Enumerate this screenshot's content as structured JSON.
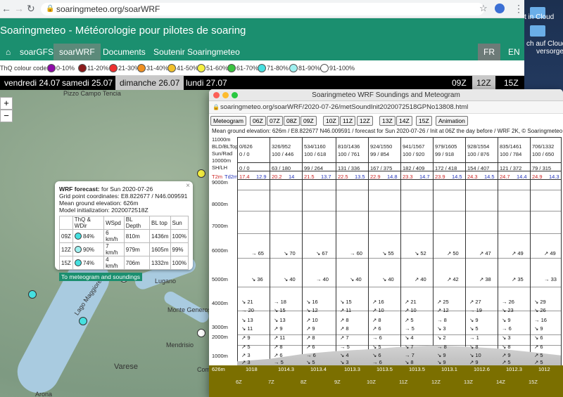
{
  "browser": {
    "url": "soaringmeteo.org/soarWRF"
  },
  "site": {
    "title": "Soaringmeteo - Météorologie pour pilotes de soaring",
    "nav": [
      "soarGFS",
      "soarWRF",
      "Documents",
      "Soutenir Soaringmeteo"
    ],
    "lang": [
      "FR",
      "EN"
    ]
  },
  "colour_code": {
    "label": "ThQ colour code:",
    "items": [
      {
        "label": "0-10%",
        "color": "#8e0aa8"
      },
      {
        "label": "11-20%",
        "color": "#8b1a1a"
      },
      {
        "label": "21-30%",
        "color": "#ee3030"
      },
      {
        "label": "31-40%",
        "color": "#f09020"
      },
      {
        "label": "41-50%",
        "color": "#f2c12a"
      },
      {
        "label": "51-60%",
        "color": "#f5f040"
      },
      {
        "label": "61-70%",
        "color": "#39c43f"
      },
      {
        "label": "71-80%",
        "color": "#46e0e0"
      },
      {
        "label": "81-90%",
        "color": "#9ef0f0"
      },
      {
        "label": "91-100%",
        "color": "#ffffff"
      }
    ]
  },
  "days": [
    "vendredi 24.07",
    "samedi 25.07",
    "dimanche 26.07",
    "lundi 27.07"
  ],
  "hours": [
    "09Z",
    "12Z",
    "15Z"
  ],
  "map_labels": [
    "Pizzo Campo Tencia",
    "Lugano",
    "Lago Maggiore",
    "Monte Generoso",
    "Mendrisio",
    "Varese",
    "Arona",
    "Como"
  ],
  "popup": {
    "title_bold": "WRF forecast:",
    "title_rest": " for Sun 2020-07-26",
    "lines": [
      "Grid point coordinates: E8.822677 / N46.009591",
      "Mean ground elevation: 626m",
      "Model initialization: 2020072518Z"
    ],
    "headers": [
      "",
      "ThQ & WDir",
      "WSpd",
      "BL Depth",
      "BL top",
      "Sun"
    ],
    "rows": [
      [
        "09Z",
        "84%",
        "6 km/h",
        "810m",
        "1436m",
        "100%"
      ],
      [
        "12Z",
        "90%",
        "7 km/h",
        "979m",
        "1605m",
        "99%"
      ],
      [
        "15Z",
        "74%",
        "4 km/h",
        "706m",
        "1332m",
        "100%"
      ]
    ],
    "link": "To meteogram and soundings"
  },
  "window": {
    "title": "Soaringmeteo WRF Soundings and Meteogram",
    "url": "soaringmeteo.org/soarWRF/2020-07-26/metSoundInit2020072518GPNo13808.html",
    "buttons": [
      "Meteogram",
      "06Z",
      "07Z",
      "08Z",
      "09Z",
      "10Z",
      "11Z",
      "12Z",
      "13Z",
      "14Z",
      "15Z",
      "Animation"
    ],
    "info": "Mean ground elevation: 626m / E8.822677 N46.009591 / forecast for Sun 2020-07-26 / Init at 06Z the day before / WRF 2K, © Soaringmeteo.",
    "row_labels": [
      "11000m",
      "BLD/BLTop",
      "Sun/Rad",
      "10000m",
      "SH/LH",
      "T2m",
      "Td2m",
      "9000m",
      "8000m",
      "7000m",
      "6000m",
      "5000m",
      "4000m",
      "3000m",
      "2000m",
      "1000m",
      "626m"
    ],
    "columns": [
      {
        "bld": "0/626",
        "sun": "0 / 0",
        "shlh": "0 / 0",
        "t2m": "17.4",
        "td2m": "12.9",
        "p": "1018"
      },
      {
        "bld": "326/952",
        "sun": "100 / 446",
        "shlh": "63 / 180",
        "t2m": "20.2",
        "td2m": "14",
        "p": "1014.3"
      },
      {
        "bld": "534/1160",
        "sun": "100 / 618",
        "shlh": "99 / 264",
        "t2m": "21.5",
        "td2m": "13.7",
        "p": "1013.4"
      },
      {
        "bld": "810/1436",
        "sun": "100 / 761",
        "shlh": "131 / 336",
        "t2m": "22.5",
        "td2m": "13.5",
        "p": "1013.3"
      },
      {
        "bld": "924/1550",
        "sun": "99 / 854",
        "shlh": "167 / 375",
        "t2m": "22.9",
        "td2m": "14.8",
        "p": "1013.5"
      },
      {
        "bld": "941/1567",
        "sun": "100 / 920",
        "shlh": "182 / 409",
        "t2m": "23.3",
        "td2m": "14.7",
        "p": "1013.5"
      },
      {
        "bld": "979/1605",
        "sun": "99 / 918",
        "shlh": "172 / 418",
        "t2m": "23.9",
        "td2m": "14.5",
        "p": "1013.1"
      },
      {
        "bld": "928/1554",
        "sun": "100 / 876",
        "shlh": "154 / 407",
        "t2m": "24.3",
        "td2m": "14.5",
        "p": "1012.6"
      },
      {
        "bld": "835/1461",
        "sun": "100 / 784",
        "shlh": "121 / 372",
        "t2m": "24.7",
        "td2m": "14.4",
        "p": "1012.3"
      },
      {
        "bld": "706/1332",
        "sun": "100 / 650",
        "shlh": "79 / 315",
        "t2m": "24.9",
        "td2m": "14.3",
        "p": "1012"
      }
    ],
    "wind_rows": [
      [
        "65",
        "70",
        "67",
        "60",
        "55",
        "52",
        "50",
        "47",
        "49",
        "49"
      ],
      [
        "36",
        "40",
        "40",
        "40",
        "40",
        "40",
        "42",
        "38",
        "35",
        "33"
      ],
      [
        "21",
        "18",
        "16",
        "15",
        "16",
        "21",
        "25",
        "27",
        "26",
        "29"
      ],
      [
        "20",
        "15",
        "12",
        "11",
        "10",
        "10",
        "12",
        "19",
        "23",
        "26"
      ],
      [
        "13",
        "13",
        "10",
        "8",
        "8",
        "5",
        "8",
        "9",
        "9",
        "16"
      ],
      [
        "11",
        "9",
        "9",
        "8",
        "6",
        "5",
        "3",
        "5",
        "6",
        "9"
      ],
      [
        "9",
        "11",
        "8",
        "7",
        "6",
        "4",
        "2",
        "1",
        "3",
        "6"
      ],
      [
        "5",
        "8",
        "6",
        "5",
        "5",
        "7",
        "8",
        "8",
        "8",
        "6"
      ],
      [
        "3",
        "6",
        "6",
        "4",
        "6",
        "7",
        "9",
        "10",
        "9",
        "5"
      ],
      [
        "3",
        "5",
        "5",
        "3",
        "6",
        "8",
        "9",
        "9",
        "5",
        "5"
      ]
    ],
    "bottom_hours": [
      "6Z",
      "7Z",
      "8Z",
      "9Z",
      "10Z",
      "11Z",
      "12Z",
      "13Z",
      "14Z",
      "15Z"
    ]
  },
  "desktop": {
    "icons": [
      "t in Cloud",
      "ch auf Cloud",
      "versorgen"
    ]
  }
}
